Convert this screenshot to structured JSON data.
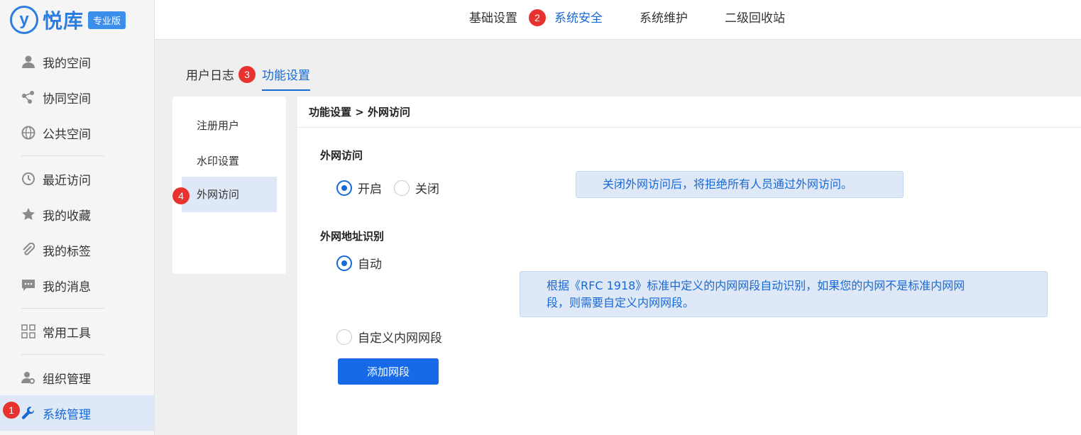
{
  "logo": {
    "mark": "y",
    "name": "悦库",
    "badge": "专业版"
  },
  "sidebar": {
    "items": [
      {
        "label": "我的空间",
        "icon": "user-icon"
      },
      {
        "label": "协同空间",
        "icon": "share-nodes-icon"
      },
      {
        "label": "公共空间",
        "icon": "globe-icon"
      },
      {
        "label": "最近访问",
        "icon": "history-icon"
      },
      {
        "label": "我的收藏",
        "icon": "star-icon"
      },
      {
        "label": "我的标签",
        "icon": "paperclip-icon"
      },
      {
        "label": "我的消息",
        "icon": "message-icon"
      },
      {
        "label": "常用工具",
        "icon": "grid-icon"
      },
      {
        "label": "组织管理",
        "icon": "user-gear-icon"
      },
      {
        "label": "系统管理",
        "icon": "wrench-icon",
        "active": true
      }
    ]
  },
  "topbar": {
    "tabs": [
      {
        "label": "基础设置"
      },
      {
        "label": "系统安全",
        "active": true
      },
      {
        "label": "系统维护"
      },
      {
        "label": "二级回收站"
      }
    ]
  },
  "subtabs": [
    {
      "label": "用户日志"
    },
    {
      "label": "功能设置",
      "active": true
    }
  ],
  "leftpanel": {
    "items": [
      {
        "label": "注册用户"
      },
      {
        "label": "水印设置"
      },
      {
        "label": "外网访问",
        "active": true
      }
    ]
  },
  "main": {
    "breadcrumb": "功能设置 > 外网访问",
    "access": {
      "title": "外网访问",
      "on_label": "开启",
      "off_label": "关闭",
      "selected": "开启",
      "notice": "关闭外网访问后，将拒绝所有人员通过外网访问。"
    },
    "detect": {
      "title": "外网地址识别",
      "auto_label": "自动",
      "custom_label": "自定义内网网段",
      "selected": "自动",
      "notice_line1": "根据《RFC 1918》标准中定义的内网网段自动识别，如果您的内网不是标准内网网",
      "notice_line2": "段，则需要自定义内网网段。",
      "add_button": "添加网段"
    }
  },
  "markers": [
    "1",
    "2",
    "3",
    "4"
  ],
  "colors": {
    "accent": "#1769d6",
    "marker": "#e8322f",
    "button": "#1769e8",
    "active_bg": "#dfe8f6"
  }
}
